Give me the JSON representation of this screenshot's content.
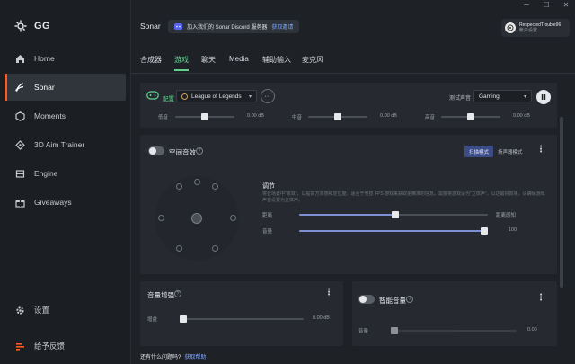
{
  "brand": {
    "name": "GG"
  },
  "sidebar": {
    "items": [
      {
        "label": "Home",
        "icon": "home-icon"
      },
      {
        "label": "Sonar",
        "icon": "sonar-icon",
        "active": true
      },
      {
        "label": "Moments",
        "icon": "moments-icon"
      },
      {
        "label": "3D Aim Trainer",
        "icon": "crosshair-icon"
      },
      {
        "label": "Engine",
        "icon": "engine-icon"
      },
      {
        "label": "Giveaways",
        "icon": "gift-icon"
      }
    ],
    "settings_label": "设置",
    "feedback_label": "给予反馈"
  },
  "window": {
    "minimize": "─",
    "maximize": "☐",
    "close": "✕"
  },
  "header": {
    "title": "Sonar",
    "discord_text": "加入我们的 Sonar Discord 服务器",
    "discord_link": "获取邀请",
    "user_name": "RespectedTrouble96",
    "user_sub": "帐户设置"
  },
  "tabs": [
    {
      "label": "合成器"
    },
    {
      "label": "游戏",
      "active": true
    },
    {
      "label": "聊天"
    },
    {
      "label": "Media"
    },
    {
      "label": "辅助输入"
    },
    {
      "label": "麦克风"
    }
  ],
  "game_panel": {
    "config_label": "配置",
    "config_value": "League of Legends",
    "test_label": "测试声音",
    "test_value": "Gaming",
    "sliders": [
      {
        "label": "低音",
        "value": "0.00 dB",
        "level": 0.5
      },
      {
        "label": "中音",
        "value": "0.00 dB",
        "level": 0.5
      },
      {
        "label": "高音",
        "value": "0.00 dB",
        "level": 0.5
      }
    ]
  },
  "spatial": {
    "title": "空间音效",
    "seg_on": "扫描模式",
    "seg_off": "扬声器模式",
    "adjust_title": "调节",
    "description": "将音场置中\"收敛\"，以提高方向感和定位度。适合于竞技 FPS 游戏来获取更精准的信息。需要将游戏设为\"立体声\"，以达最好效果，请确保游戏声音设置为立体声。",
    "sliders": [
      {
        "label": "距离",
        "end_label": "距离感知",
        "level": 0.51
      },
      {
        "label": "音量",
        "end_label": "100",
        "level": 0.99
      }
    ]
  },
  "bass_boost": {
    "title": "音量增强",
    "slider_label": "增益",
    "slider_value": "0.00 dB",
    "level": 0.02
  },
  "smart_volume": {
    "title": "智能音量",
    "slider_label": "音量",
    "slider_value": "0.00",
    "level": 0.02
  },
  "footer": {
    "question": "还有什么问题吗?",
    "link": "获取帮助"
  }
}
